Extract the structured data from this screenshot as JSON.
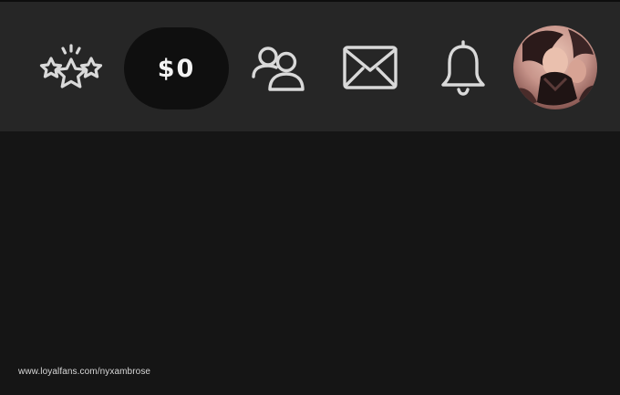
{
  "header": {
    "stars_icon": "stars-icon",
    "wallet": {
      "balance_label": "$0"
    },
    "friends_icon": "users-icon",
    "messages_icon": "envelope-icon",
    "notifications_icon": "bell-icon",
    "avatar_icon": "user-avatar"
  },
  "footer": {
    "watermark": "www.loyalfans.com/nyxambrose"
  },
  "colors": {
    "header_bg": "#262626",
    "page_bg": "#151515",
    "wallet_bg": "#0f0f0f",
    "icon_stroke": "#d9d9d9"
  }
}
